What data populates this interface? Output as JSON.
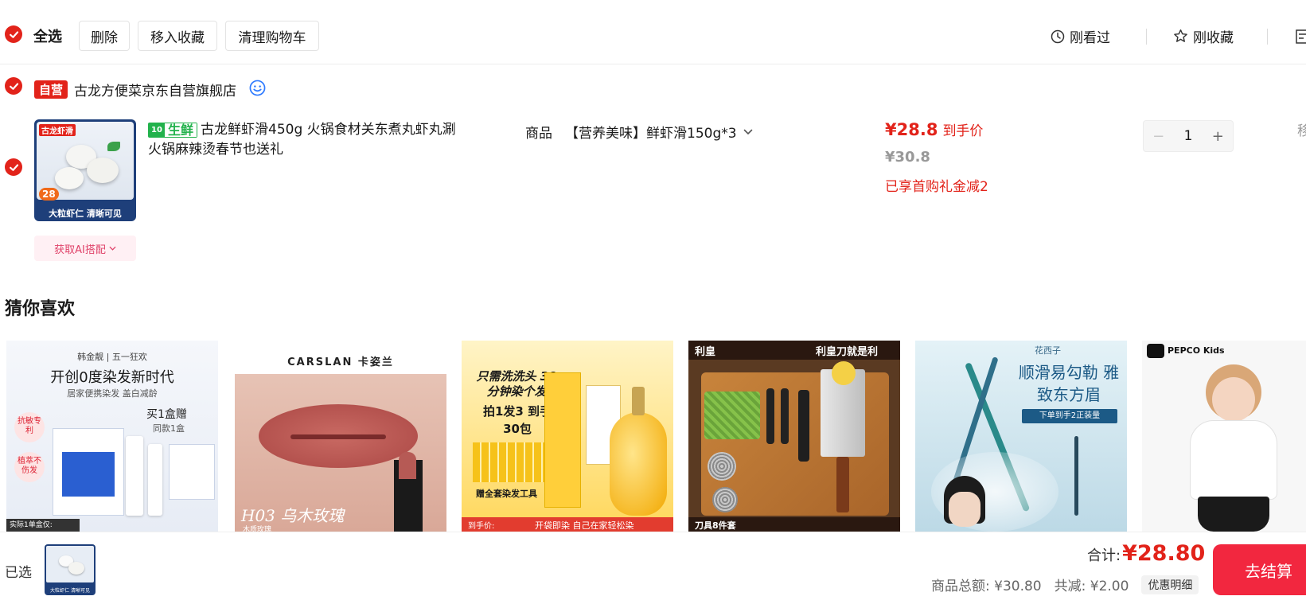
{
  "toolbar": {
    "select_all": "全选",
    "delete": "删除",
    "move_to_favorites": "移入收藏",
    "clear_cart": "清理购物车",
    "recently_viewed": "刚看过",
    "recently_favorited": "刚收藏"
  },
  "shop": {
    "badge": "自营",
    "name": "古龙方便菜京东自营旗舰店"
  },
  "item": {
    "tag": "生鲜",
    "title_line1": "古龙鲜虾滑450g 火锅食材关东煮丸虾丸涮",
    "title_line2": "火锅麻辣烫春节也送礼",
    "spec_label": "商品",
    "spec_value": "【营养美味】鲜虾滑150g*3",
    "price": "¥28.8",
    "price_label": "到手价",
    "original_price": "¥30.8",
    "promo": "已享首购礼金减2",
    "quantity": "1",
    "ai_match": "获取AI搭配",
    "thumb_text_top": "古龙虾滑",
    "thumb_text_bottom": "大粒虾仁 清晰可见",
    "thumb_price": "28"
  },
  "recommend": {
    "title": "猜你喜欢",
    "cards": [
      {
        "brand": "韩金靓 | 五一狂欢",
        "headline": "开创0度染发新时代",
        "sub": "居家便携染发 盖白减龄",
        "badge1": "抗敏专利",
        "badge2": "植萃不伤发",
        "offer": "买1盒赠",
        "offer2": "同款1盒",
        "foot": "实际1单盒仅:"
      },
      {
        "brand": "CARSLAN 卡姿兰",
        "headline": "H03 乌木玫瑰",
        "sub": "木质玫瑰"
      },
      {
        "headline": "只需洗洗头 30分钟染个发",
        "sub": "拍1发3 到手30包",
        "foot": "赠全套染发工具",
        "price_label": "到手价:",
        "bottom": "开袋即染 自己在家轻松染"
      },
      {
        "brand": "利皇",
        "headline": "利皇刀就是利",
        "bottom": "刀具8件套"
      },
      {
        "brand": "花西子",
        "headline": "顺滑易勾勒 雅致东方眉",
        "sub": "下单到手2正装量"
      },
      {
        "brand": "PEPCO Kids"
      }
    ]
  },
  "bottom": {
    "selected_label": "已选",
    "total_label": "合计:",
    "total_value": "¥28.80",
    "goods_total": "商品总额: ¥30.80",
    "discount": "共减: ¥2.00",
    "detail": "优惠明细",
    "checkout": "去结算"
  },
  "colors": {
    "accent": "#e2231a",
    "checkout": "#f2273f",
    "fresh": "#22b24c"
  }
}
